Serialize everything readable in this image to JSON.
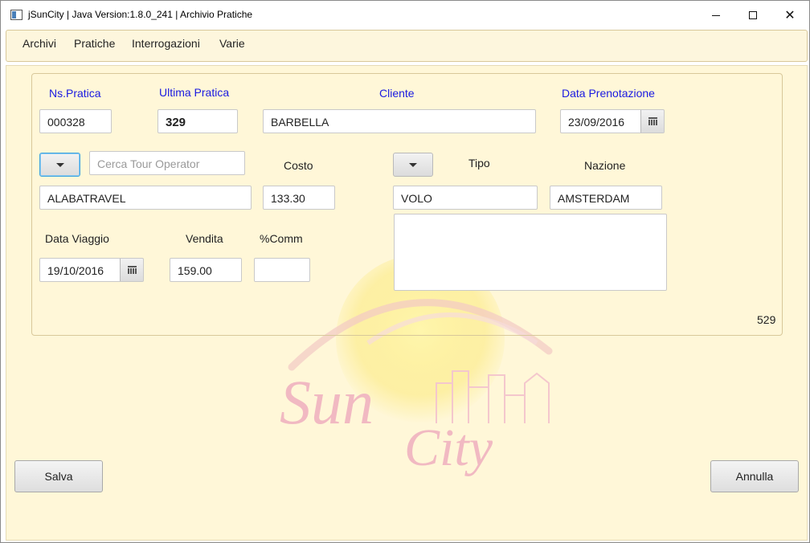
{
  "window": {
    "title": "jSunCity | Java Version:1.8.0_241 | Archivio Pratiche",
    "minimize_icon": "minimize-icon",
    "maximize_icon": "maximize-icon",
    "close_icon": "close-icon",
    "close_glyph": "✕"
  },
  "menu": {
    "items": [
      {
        "label": "Archivi"
      },
      {
        "label": "Pratiche"
      },
      {
        "label": "Interrogazioni"
      },
      {
        "label": "Varie"
      }
    ]
  },
  "form": {
    "ns_pratica": {
      "label": "Ns.Pratica",
      "value": "000328"
    },
    "ultima_pratica": {
      "label": "Ultima Pratica",
      "value": "329"
    },
    "cliente": {
      "label": "Cliente",
      "value": "BARBELLA"
    },
    "data_prenotazione": {
      "label": "Data Prenotazione",
      "value": "23/09/2016"
    },
    "tour_operator": {
      "search_placeholder": "Cerca Tour Operator",
      "value": "ALABATRAVEL"
    },
    "costo": {
      "label": "Costo",
      "value": "133.30"
    },
    "tipo": {
      "label": "Tipo",
      "value": "VOLO"
    },
    "nazione": {
      "label": "Nazione",
      "value": "AMSTERDAM"
    },
    "data_viaggio": {
      "label": "Data Viaggio",
      "value": "19/10/2016"
    },
    "vendita": {
      "label": "Vendita",
      "value": "159.00"
    },
    "comm": {
      "label": "%Comm",
      "value": ""
    },
    "note": {
      "value": ""
    },
    "counter": "529"
  },
  "watermark": {
    "text_1": "Sun",
    "text_2": "City"
  },
  "colors": {
    "accent_label": "#1a1ae0",
    "background": "#fff7d8"
  },
  "buttons": {
    "save": "Salva",
    "cancel": "Annulla"
  }
}
